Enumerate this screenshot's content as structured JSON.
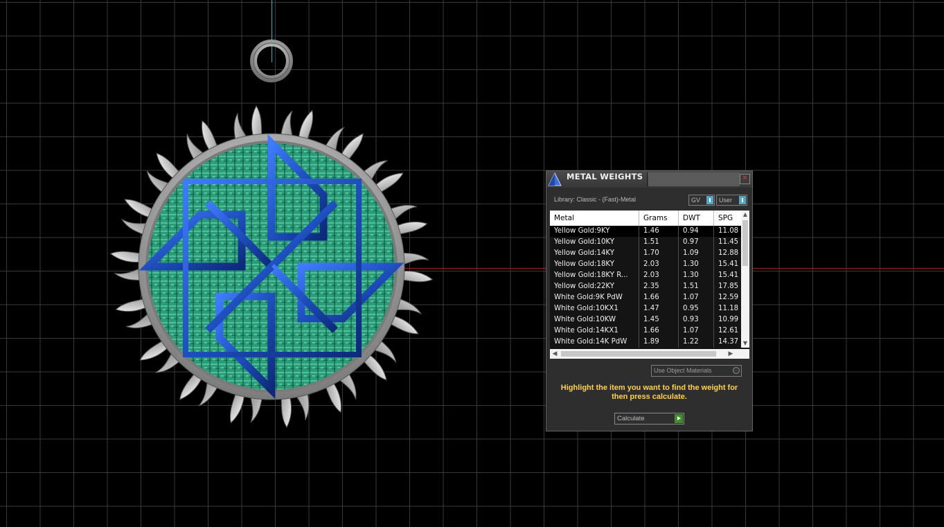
{
  "panel": {
    "title": "METAL WEIGHTS",
    "close_glyph": "✕",
    "library_label": "Library: Classic - (Fast)-Metal",
    "gv_label": "GV",
    "user_label": "User",
    "columns": [
      "Metal",
      "Grams",
      "DWT",
      "SPG"
    ],
    "rows": [
      {
        "metal": "Yellow Gold:9KY",
        "grams": "1.46",
        "dwt": "0.94",
        "spg": "11.08",
        "selected": true
      },
      {
        "metal": "Yellow Gold:10KY",
        "grams": "1.51",
        "dwt": "0.97",
        "spg": "11.45"
      },
      {
        "metal": "Yellow Gold:14KY",
        "grams": "1.70",
        "dwt": "1.09",
        "spg": "12.88"
      },
      {
        "metal": "Yellow Gold:18KY",
        "grams": "2.03",
        "dwt": "1.30",
        "spg": "15.41"
      },
      {
        "metal": "Yellow Gold:18KY R...",
        "grams": "2.03",
        "dwt": "1.30",
        "spg": "15.41"
      },
      {
        "metal": "Yellow Gold:22KY",
        "grams": "2.35",
        "dwt": "1.51",
        "spg": "17.85"
      },
      {
        "metal": "White Gold:9K PdW",
        "grams": "1.66",
        "dwt": "1.07",
        "spg": "12.59"
      },
      {
        "metal": "White Gold:10KX1",
        "grams": "1.47",
        "dwt": "0.95",
        "spg": "11.18"
      },
      {
        "metal": "White Gold:10KW",
        "grams": "1.45",
        "dwt": "0.93",
        "spg": "10.99"
      },
      {
        "metal": "White Gold:14KX1",
        "grams": "1.66",
        "dwt": "1.07",
        "spg": "12.61"
      },
      {
        "metal": "White Gold:14K PdW",
        "grams": "1.89",
        "dwt": "1.22",
        "spg": "14.37"
      }
    ],
    "use_object_materials_label": "Use Object Materials",
    "hint_text": "Highlight the item you want to find the weight for then press calculate.",
    "calculate_label": "Calculate"
  },
  "colors": {
    "accent_toggle": "#56a7c7",
    "hint": "#ffd24a",
    "calculate_go": "#3e8e2a",
    "enamel_blue": "#1f4fbf",
    "enamel_green": "#2fa37c",
    "silver": "#c0c0c0"
  },
  "icons": {
    "panel_logo": "pyramid-logo-icon",
    "close": "close-icon",
    "scroll_up": "scroll-up-arrow-icon",
    "scroll_down": "scroll-down-arrow-icon",
    "scroll_left": "scroll-left-arrow-icon",
    "scroll_right": "scroll-right-arrow-icon",
    "calculate_go": "play-arrow-icon"
  }
}
